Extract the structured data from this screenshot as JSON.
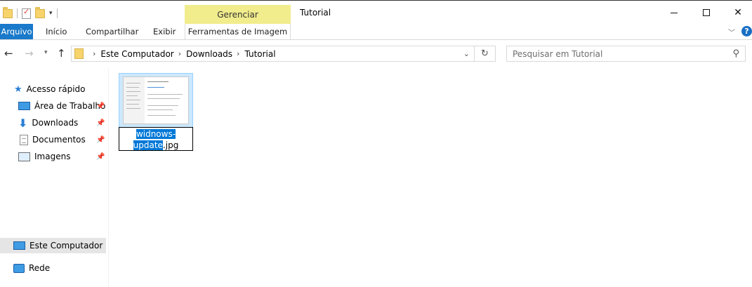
{
  "window": {
    "title": "Tutorial",
    "context_tab_group": "Gerenciar"
  },
  "ribbon": {
    "tabs": [
      "Arquivo",
      "Início",
      "Compartilhar",
      "Exibir",
      "Ferramentas de Imagem"
    ]
  },
  "navigation": {
    "breadcrumb": [
      "Este Computador",
      "Downloads",
      "Tutorial"
    ],
    "search_placeholder": "Pesquisar em Tutorial"
  },
  "sidebar": {
    "quick_access": "Acesso rápido",
    "pinned": [
      "Área de Trabalho",
      "Downloads",
      "Documentos",
      "Imagens"
    ],
    "this_pc": "Este Computador",
    "network": "Rede"
  },
  "content": {
    "file": {
      "name_line1": "widnows-",
      "name_line2_selected": "update",
      "extension": ".jpg"
    }
  },
  "colors": {
    "accent": "#1979ca",
    "context_tab": "#f1ec8c",
    "selection": "#cce8ff"
  }
}
